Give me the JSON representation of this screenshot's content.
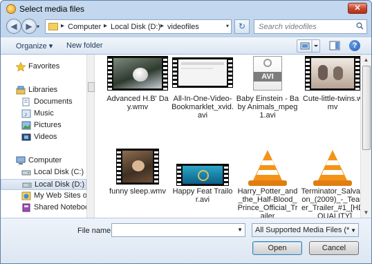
{
  "window": {
    "title": "Select media files",
    "close_glyph": "✕"
  },
  "address": {
    "back_glyph": "◀",
    "forward_glyph": "▶",
    "dropdown_glyph": "▾",
    "crumbs": [
      "Computer",
      "Local Disk (D:)",
      "videofiles"
    ],
    "separator": "▸",
    "refresh_glyph": "↻",
    "search_placeholder": "Search videofiles"
  },
  "toolbar": {
    "organize_label": "Organize ▾",
    "new_folder_label": "New folder",
    "help_glyph": "?"
  },
  "nav": {
    "items": [
      {
        "label": "Favorites",
        "icon": "star-icon"
      },
      {
        "label": "Libraries",
        "icon": "libraries-icon"
      },
      {
        "label": "Documents",
        "icon": "documents-icon"
      },
      {
        "label": "Music",
        "icon": "music-icon"
      },
      {
        "label": "Pictures",
        "icon": "pictures-icon"
      },
      {
        "label": "Videos",
        "icon": "videos-icon"
      },
      {
        "label": "Computer",
        "icon": "computer-icon"
      },
      {
        "label": "Local Disk (C:)",
        "icon": "drive-icon"
      },
      {
        "label": "Local Disk (D:)",
        "icon": "drive-icon",
        "selected": true
      },
      {
        "label": "My Web Sites on",
        "icon": "web-sites-icon"
      },
      {
        "label": "Shared Notebook",
        "icon": "notebook-icon"
      }
    ]
  },
  "files": [
    {
      "name": "Advanced H.B' Day.wmv",
      "icon": "video-thumbnail-icon"
    },
    {
      "name": "All-In-One-Video-Bookmarklet_xvid.avi",
      "icon": "video-thumbnail-icon"
    },
    {
      "name": "Baby Einstein - Baby Animals_mpeg1.avi",
      "icon": "avi-file-icon",
      "badge": "AVI"
    },
    {
      "name": "Cute-little-twins.wmv",
      "icon": "video-thumbnail-icon"
    },
    {
      "name": "funny sleep.wmv",
      "icon": "video-thumbnail-icon"
    },
    {
      "name": "Happy Feat Trailor.avi",
      "icon": "video-thumbnail-icon"
    },
    {
      "name": "Harry_Potter_and_the_Half-Blood_Prince_Official_Trailer",
      "icon": "vlc-cone-icon"
    },
    {
      "name": "Terminator_Salvation_(2009)_-_Teaser_Trailer_#1_[HD_QUALITY]",
      "icon": "vlc-cone-icon"
    }
  ],
  "footer": {
    "file_name_label": "File name:",
    "file_name_value": "",
    "filter_value": "All Supported Media Files (*.aifl",
    "open_label": "Open",
    "cancel_label": "Cancel"
  }
}
